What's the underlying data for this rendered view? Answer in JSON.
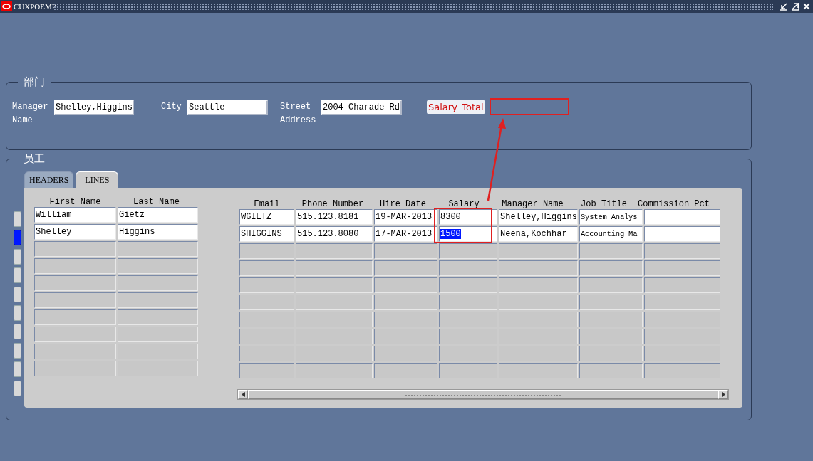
{
  "window": {
    "title": "CUXPOEMP"
  },
  "department": {
    "legend": "部门",
    "fields": [
      {
        "label": "Manager Name",
        "value": "Shelley,Higgins"
      },
      {
        "label": "City",
        "value": "Seattle"
      },
      {
        "label": "Street Address",
        "value": "2004 Charade Rd"
      }
    ]
  },
  "annotation": {
    "label": "Salary_Total"
  },
  "employees": {
    "legend": "员工",
    "tabs": [
      {
        "label": "HEADERS",
        "selected": false
      },
      {
        "label": "LINES",
        "selected": true
      }
    ],
    "name_columns": [
      "First Name",
      "Last Name"
    ],
    "detail_columns": [
      "Email",
      "Phone Number",
      "Hire Date",
      "Salary",
      "Manager Name",
      "Job Title",
      "Commission Pct"
    ],
    "rows": [
      {
        "selected": false,
        "names": [
          "William",
          "Gietz"
        ],
        "cells": [
          "WGIETZ",
          "515.123.8181",
          "19-MAR-2013",
          "8300",
          "Shelley,Higgins",
          "System Analys"
        ]
      },
      {
        "selected": true,
        "names": [
          "Shelley",
          "Higgins"
        ],
        "cells": [
          "SHIGGINS",
          "515.123.8080",
          "17-MAR-2013",
          "1500",
          "Neena,Kochhar",
          "Accounting Ma"
        ]
      }
    ]
  }
}
